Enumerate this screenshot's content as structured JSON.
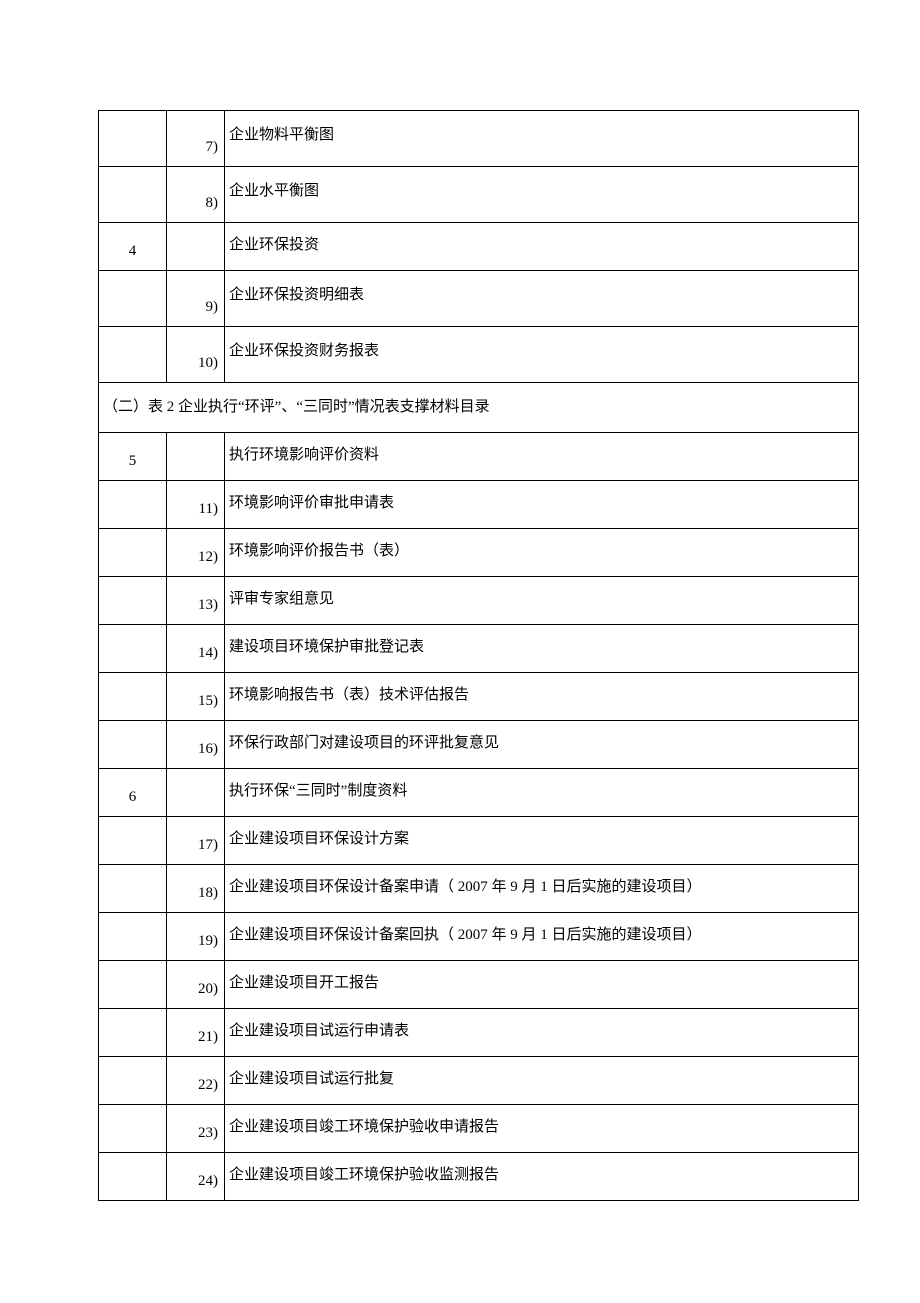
{
  "rows": [
    {
      "type": "item",
      "col1": "",
      "col2": "7)",
      "col3": "企业物料平衡图",
      "tall": true
    },
    {
      "type": "item",
      "col1": "",
      "col2": "8)",
      "col3": "企业水平衡图",
      "tall": true
    },
    {
      "type": "item",
      "col1": "4",
      "col2": "",
      "col3": "企业环保投资",
      "tall": false
    },
    {
      "type": "item",
      "col1": "",
      "col2": "9)",
      "col3": "企业环保投资明细表",
      "tall": true
    },
    {
      "type": "item",
      "col1": "",
      "col2": "10)",
      "col3": "企业环保投资财务报表",
      "tall": true
    },
    {
      "type": "section",
      "text": "（二）表 2 企业执行“环评”、“三同时”情况表支撑材料目录"
    },
    {
      "type": "item",
      "col1": "5",
      "col2": "",
      "col3": "执行环境影响评价资料",
      "tall": false
    },
    {
      "type": "item",
      "col1": "",
      "col2": "11)",
      "col3": "环境影响评价审批申请表",
      "tall": false
    },
    {
      "type": "item",
      "col1": "",
      "col2": "12)",
      "col3": "环境影响评价报告书（表）",
      "tall": false
    },
    {
      "type": "item",
      "col1": "",
      "col2": "13)",
      "col3": "评审专家组意见",
      "tall": false
    },
    {
      "type": "item",
      "col1": "",
      "col2": "14)",
      "col3": "建设项目环境保护审批登记表",
      "tall": false
    },
    {
      "type": "item",
      "col1": "",
      "col2": "15)",
      "col3": "环境影响报告书（表）技术评估报告",
      "tall": false
    },
    {
      "type": "item",
      "col1": "",
      "col2": "16)",
      "col3": "环保行政部门对建设项目的环评批复意见",
      "tall": false
    },
    {
      "type": "item",
      "col1": "6",
      "col2": "",
      "col3": "执行环保“三同时”制度资料",
      "tall": false
    },
    {
      "type": "item",
      "col1": "",
      "col2": "17)",
      "col3": "企业建设项目环保设计方案",
      "tall": false
    },
    {
      "type": "item",
      "col1": "",
      "col2": "18)",
      "col3": "企业建设项目环保设计备案申请（ 2007 年 9 月 1 日后实施的建设项目）",
      "tall": false
    },
    {
      "type": "item",
      "col1": "",
      "col2": "19)",
      "col3": "企业建设项目环保设计备案回执（ 2007 年 9 月 1 日后实施的建设项目）",
      "tall": false
    },
    {
      "type": "item",
      "col1": "",
      "col2": "20)",
      "col3": "企业建设项目开工报告",
      "tall": false
    },
    {
      "type": "item",
      "col1": "",
      "col2": "21)",
      "col3": "企业建设项目试运行申请表",
      "tall": false
    },
    {
      "type": "item",
      "col1": "",
      "col2": "22)",
      "col3": "企业建设项目试运行批复",
      "tall": false
    },
    {
      "type": "item",
      "col1": "",
      "col2": "23)",
      "col3": "企业建设项目竣工环境保护验收申请报告",
      "tall": false
    },
    {
      "type": "item",
      "col1": "",
      "col2": "24)",
      "col3": "企业建设项目竣工环境保护验收监测报告",
      "tall": false
    }
  ]
}
